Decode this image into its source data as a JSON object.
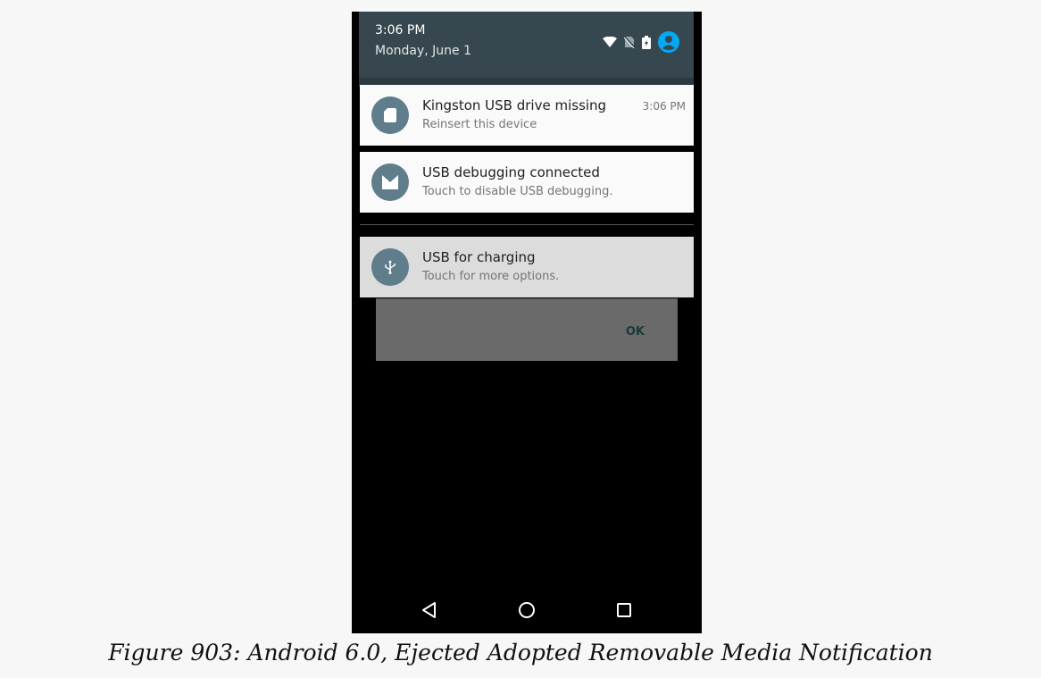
{
  "status_bar": {
    "time": "3:06 PM",
    "date": "Monday, June 1"
  },
  "notifications": [
    {
      "title": "Kingston USB drive missing",
      "text": "Reinsert this device",
      "time": "3:06 PM",
      "icon": "sd-card-icon"
    },
    {
      "title": "USB debugging connected",
      "text": "Touch to disable USB debugging.",
      "icon": "android-m-icon"
    },
    {
      "title": "USB for charging",
      "text": "Touch for more options.",
      "icon": "usb-icon"
    }
  ],
  "dialog": {
    "ok_label": "OK"
  },
  "caption": "Figure 903: Android 6.0, Ejected Adopted Removable Media Notification",
  "colors": {
    "header_bg": "#37474f",
    "icon_circle": "#607d8b",
    "account_accent": "#03a9f4"
  }
}
